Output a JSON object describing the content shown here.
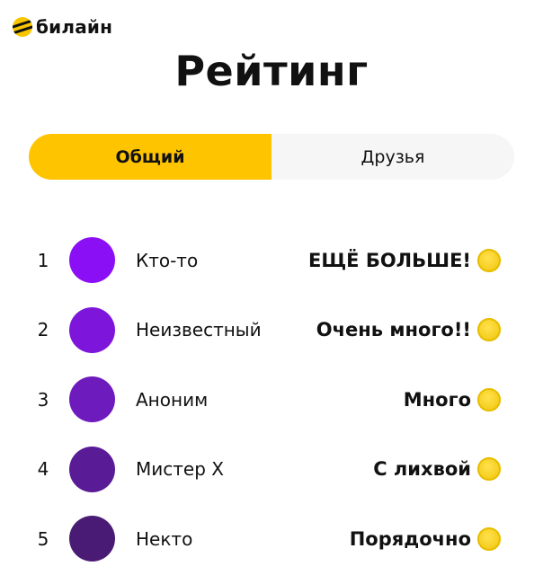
{
  "brand": {
    "name": "билайн",
    "logo_icon": "beeline-logo-icon",
    "logo_color": "#f7c600"
  },
  "page": {
    "title": "Рейтинг"
  },
  "tabs": [
    {
      "label": "Общий",
      "active": true
    },
    {
      "label": "Друзья",
      "active": false
    }
  ],
  "colors": {
    "accent": "#ffc400",
    "tab_background": "#f6f6f6",
    "coin": "#f6d024"
  },
  "leaderboard": [
    {
      "rank": "1",
      "name": "Кто-то",
      "score": "ЕЩЁ БОЛЬШЕ!",
      "avatar_color": "#8b0ff5"
    },
    {
      "rank": "2",
      "name": "Неизвестный",
      "score": "Очень много!!",
      "avatar_color": "#7d16da"
    },
    {
      "rank": "3",
      "name": "Аноним",
      "score": "Много",
      "avatar_color": "#6e1bbd"
    },
    {
      "rank": "4",
      "name": "Мистер Х",
      "score": "С лихвой",
      "avatar_color": "#5a1b96"
    },
    {
      "rank": "5",
      "name": "Некто",
      "score": "Порядочно",
      "avatar_color": "#4a1b74"
    }
  ]
}
